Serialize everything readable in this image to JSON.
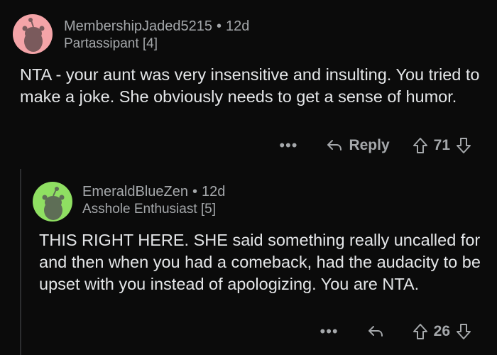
{
  "comments": [
    {
      "username": "MembershipJaded5215",
      "age": "12d",
      "flair": "Partassipant [4]",
      "body": "NTA - your aunt was very insensitive and insulting. You tried to make a joke.  She obviously needs to get a sense of humor.",
      "reply_label": "Reply",
      "score": "71",
      "avatar_color": "#f4a4a8"
    },
    {
      "username": "EmeraldBlueZen",
      "age": "12d",
      "flair": "Asshole Enthusiast [5]",
      "body": "THIS RIGHT HERE.  SHE said something really uncalled for and then when you had a comeback, had the audacity to be upset with you instead of apologizing.  You are NTA.",
      "reply_label": "",
      "score": "26",
      "avatar_color": "#8fdf62"
    }
  ],
  "separator": "•",
  "more_label": "•••"
}
